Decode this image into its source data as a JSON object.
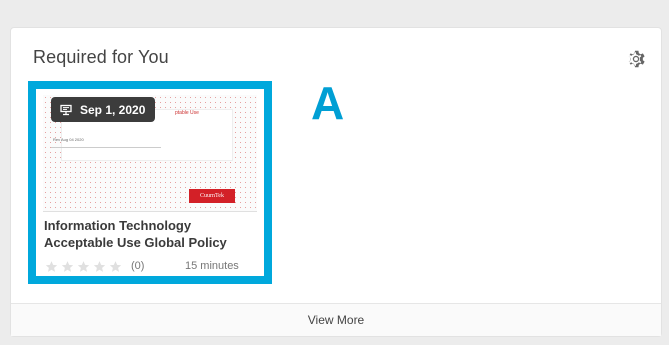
{
  "widget": {
    "title": "Required for You",
    "settings_icon": "gear-icon",
    "annotation_letter": "A",
    "footer_label": "View More"
  },
  "course": {
    "due_date": "Sep 1, 2020",
    "date_icon": "calendar-badge-icon",
    "title_line1": "Information Technology",
    "title_line2": "Acceptable Use Global Policy",
    "rating_count": "(0)",
    "duration": "15 minutes",
    "stars_filled": 0,
    "stars_total": 5,
    "thumbnail": {
      "doc_title": "ptable Use",
      "doc_sub": "Rev Aug 04 2020",
      "logo_text": "CuurnTek"
    }
  },
  "colors": {
    "highlight": "#00a8dc",
    "annotation": "#009fd4",
    "badge_bg": "#3c3c3c",
    "logo_bg": "#d32027"
  }
}
